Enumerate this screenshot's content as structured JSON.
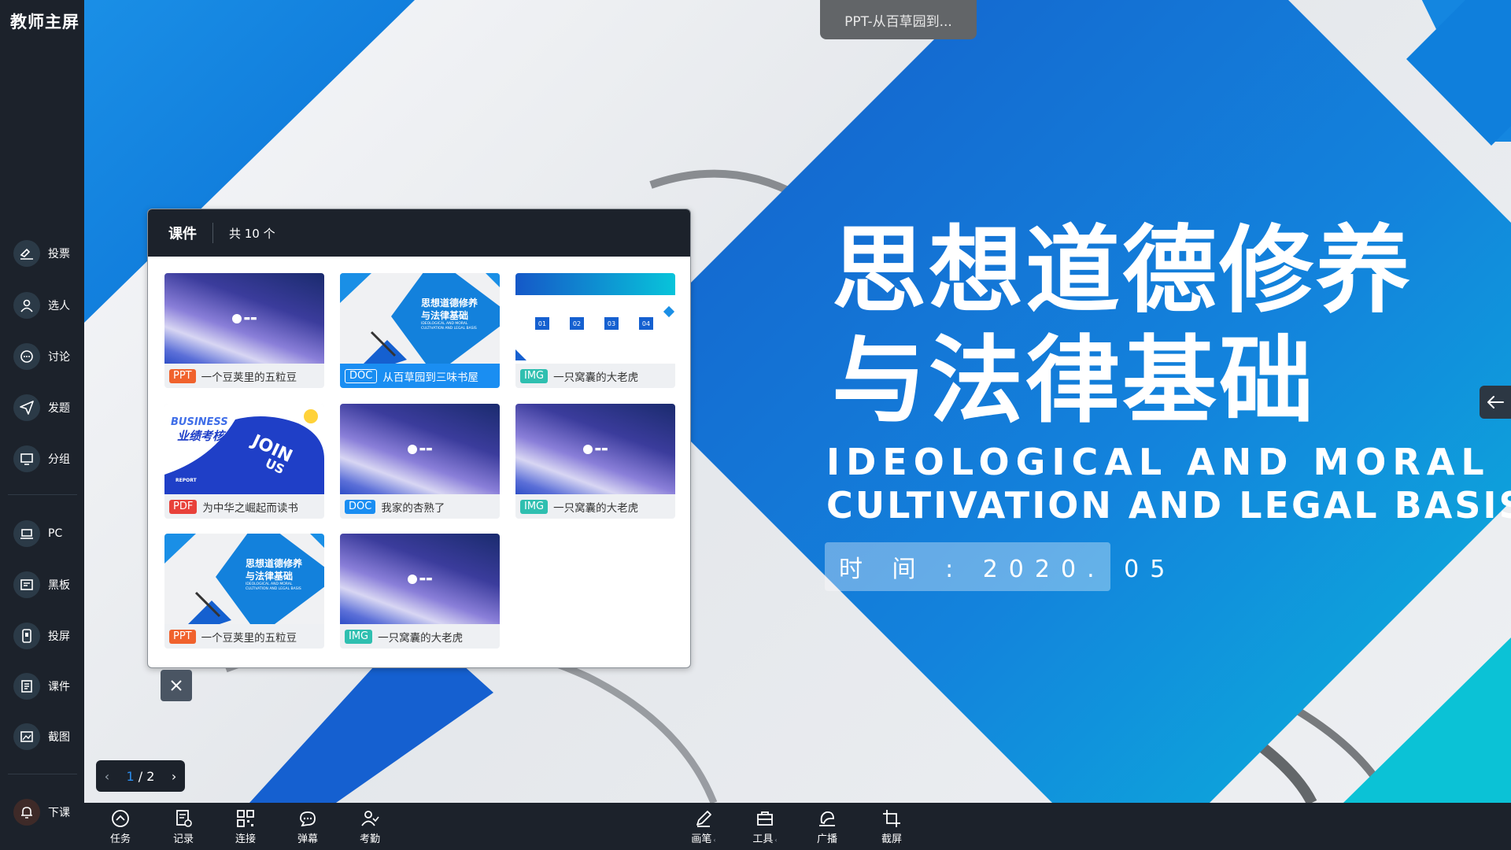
{
  "app": {
    "title": "教师主屏"
  },
  "sidebar": {
    "items": [
      {
        "label": "投票",
        "icon": "vote-icon"
      },
      {
        "label": "选人",
        "icon": "user-icon"
      },
      {
        "label": "讨论",
        "icon": "chat-icon"
      },
      {
        "label": "发题",
        "icon": "send-icon"
      },
      {
        "label": "分组",
        "icon": "monitor-icon"
      },
      {
        "label": "PC",
        "icon": "laptop-icon"
      },
      {
        "label": "黑板",
        "icon": "blackboard-icon"
      },
      {
        "label": "投屏",
        "icon": "cast-icon"
      },
      {
        "label": "课件",
        "icon": "courseware-icon"
      },
      {
        "label": "截图",
        "icon": "screenshot-icon"
      }
    ],
    "end_label": "下课"
  },
  "bottom_bar": {
    "left": [
      {
        "label": "任务",
        "icon": "task-icon"
      },
      {
        "label": "记录",
        "icon": "record-icon"
      },
      {
        "label": "连接",
        "icon": "qrcode-icon"
      },
      {
        "label": "弹幕",
        "icon": "danmu-icon"
      },
      {
        "label": "考勤",
        "icon": "attendance-icon"
      }
    ],
    "center": [
      {
        "label": "画笔",
        "icon": "pen-icon",
        "caret": "‹"
      },
      {
        "label": "工具",
        "icon": "toolbox-icon",
        "caret": "‹"
      },
      {
        "label": "广播",
        "icon": "broadcast-icon"
      },
      {
        "label": "截屏",
        "icon": "crop-icon"
      }
    ]
  },
  "document_tab": "PPT-从百草园到...",
  "slide": {
    "title_line1": "思想道德修养",
    "title_line2": "与法律基础",
    "subtitle_line1": "IDEOLOGICAL AND MORAL",
    "subtitle_line2": "CULTIVATION AND LEGAL BASIS",
    "date": "时 间 : 2020. 05"
  },
  "panel": {
    "title": "课件",
    "count": "共 10 个",
    "items": [
      {
        "type": "PPT",
        "name": "一个豆荚里的五粒豆",
        "thumb": "purple"
      },
      {
        "type": "DOC",
        "name": "从百草园到三味书屋",
        "thumb": "cover",
        "selected": true
      },
      {
        "type": "IMG",
        "name": "一只窝囊的大老虎",
        "thumb": "table"
      },
      {
        "type": "PDF",
        "name": "为中华之崛起而读书",
        "thumb": "biz"
      },
      {
        "type": "DOC",
        "name": "我家的杏熟了",
        "thumb": "purple"
      },
      {
        "type": "IMG",
        "name": "一只窝囊的大老虎",
        "thumb": "purple"
      },
      {
        "type": "PPT",
        "name": "一个豆荚里的五粒豆",
        "thumb": "cover"
      },
      {
        "type": "IMG",
        "name": "一只窝囊的大老虎",
        "thumb": "purple"
      }
    ],
    "thumb_text": {
      "cover_title1": "思想道德修养",
      "cover_title2": "与法律基础",
      "cover_sub1": "IDEOLOGICAL AND MORAL",
      "cover_sub2": "CULTIVATION AND LEGAL BASIS",
      "table_nums": [
        "01",
        "02",
        "03",
        "04"
      ],
      "biz_title1": "BUSINESS",
      "biz_title2": "业绩考核",
      "biz_join": "JOIN",
      "biz_us": "US",
      "biz_report": "REPORT"
    }
  },
  "pager": {
    "current": "1",
    "total": "2"
  },
  "colors": {
    "accent": "#1a8ef2",
    "sidebar_bg": "#1c222b",
    "ppt_badge": "#f0622d",
    "doc_badge": "#1a8ef2",
    "img_badge": "#2fbfb0",
    "pdf_badge": "#e8413a"
  }
}
